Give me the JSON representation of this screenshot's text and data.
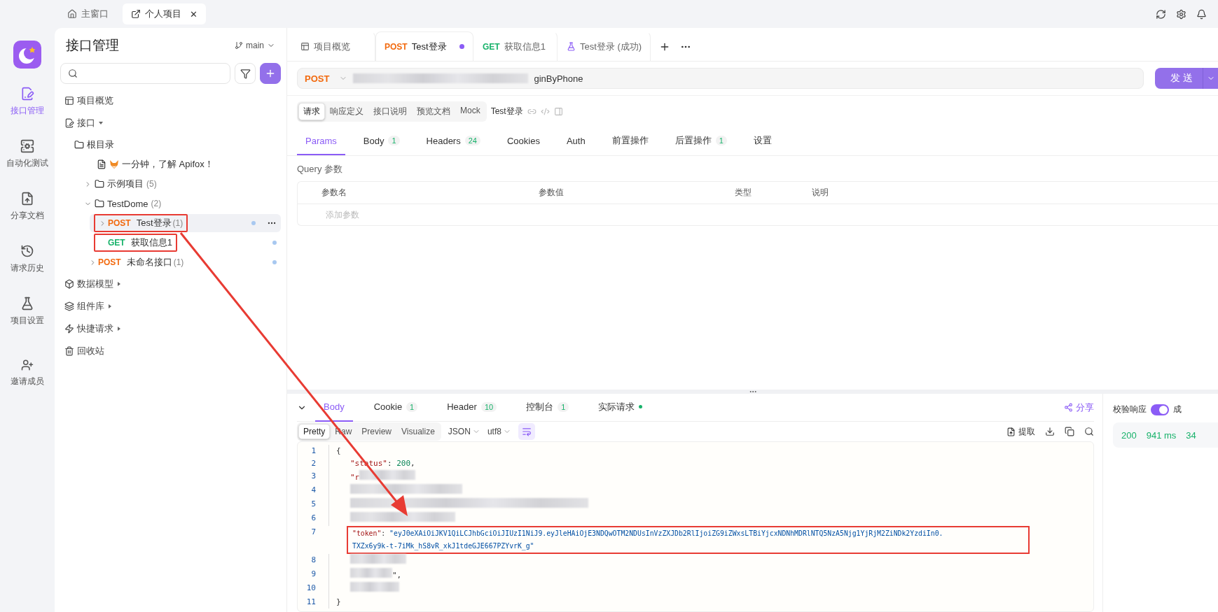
{
  "top_tabs": [
    {
      "kind": "home",
      "label": "主窗口",
      "selected": false
    },
    {
      "kind": "project",
      "label": "个人项目",
      "selected": true,
      "close": "✕"
    }
  ],
  "rail": {
    "items": [
      {
        "label": "接口管理",
        "selected": true
      },
      {
        "label": "自动化测试",
        "selected": false
      },
      {
        "label": "分享文档",
        "selected": false
      },
      {
        "label": "请求历史",
        "selected": false
      },
      {
        "label": "项目设置",
        "selected": false
      }
    ],
    "footer": {
      "label": "邀请成员"
    }
  },
  "sidebar": {
    "title": "接口管理",
    "branch": "main",
    "items": [
      {
        "kind": "overview",
        "label": "项目概览"
      },
      {
        "kind": "api",
        "label": "接口",
        "expanded": true,
        "children": [
          {
            "kind": "root",
            "label": "根目录",
            "children": [
              {
                "kind": "doc",
                "label": "一分钟，了解 Apifox！"
              },
              {
                "kind": "folder",
                "label": "示例项目",
                "count": "(5)",
                "expanded": false
              },
              {
                "kind": "folder",
                "label": "TestDome",
                "count": "(2)",
                "expanded": true,
                "children": [
                  {
                    "kind": "endpoint",
                    "method": "POST",
                    "color": "#f26a0f",
                    "label": "Test登录",
                    "count": "(1)",
                    "expandable": true,
                    "selected": true,
                    "annotated": true
                  },
                  {
                    "kind": "endpoint",
                    "method": "GET",
                    "color": "#17b26a",
                    "label": "获取信息1",
                    "expandable": false,
                    "selected": false,
                    "annotated": true
                  }
                ]
              },
              {
                "kind": "endpoint",
                "method": "POST",
                "color": "#f26a0f",
                "label": "未命名接口",
                "count": "(1)",
                "expandable": true,
                "selected": false,
                "annotated": false
              }
            ]
          }
        ]
      },
      {
        "kind": "model",
        "label": "数据模型",
        "expanded": false
      },
      {
        "kind": "components",
        "label": "组件库",
        "expanded": false
      },
      {
        "kind": "quick",
        "label": "快捷请求",
        "expanded": false
      },
      {
        "kind": "trash",
        "label": "回收站"
      }
    ]
  },
  "editor_tabs": [
    {
      "kind": "overview",
      "label": "项目概览",
      "selected": false
    },
    {
      "kind": "endpoint",
      "method": "POST",
      "color": "#f26a0f",
      "label": "Test登录",
      "selected": true,
      "modified": true
    },
    {
      "kind": "endpoint",
      "method": "GET",
      "color": "#17b26a",
      "label": "获取信息1",
      "selected": false,
      "modified": false
    },
    {
      "kind": "case",
      "label": "Test登录 (成功)",
      "selected": false
    }
  ],
  "request": {
    "method": "POST",
    "color": "#f26a0f",
    "url": "ginByPhone",
    "send": "发送"
  },
  "mode_tabs": [
    {
      "label": "请求",
      "selected": true
    },
    {
      "label": "响应定义",
      "selected": false
    },
    {
      "label": "接口说明",
      "selected": false
    },
    {
      "label": "预览文档",
      "selected": false
    },
    {
      "label": "Mock",
      "selected": false
    }
  ],
  "api_name": "Test登录",
  "param_tabs": [
    {
      "label": "Params",
      "selected": true
    },
    {
      "label": "Body",
      "count": "1",
      "selected": false
    },
    {
      "label": "Headers",
      "count": "24",
      "selected": false
    },
    {
      "label": "Cookies",
      "selected": false
    },
    {
      "label": "Auth",
      "selected": false
    },
    {
      "label": "前置操作",
      "selected": false
    },
    {
      "label": "后置操作",
      "count": "1",
      "selected": false
    },
    {
      "label": "设置",
      "selected": false
    }
  ],
  "query": {
    "title": "Query 参数",
    "columns": [
      "参数名",
      "参数值",
      "类型",
      "说明"
    ],
    "placeholder": "添加参数"
  },
  "response": {
    "tabs": [
      {
        "label": "Body",
        "selected": true
      },
      {
        "label": "Cookie",
        "count": "1",
        "selected": false
      },
      {
        "label": "Header",
        "count": "10",
        "selected": false
      },
      {
        "label": "控制台",
        "count": "1",
        "selected": false
      },
      {
        "label": "实际请求",
        "dot": true,
        "selected": false
      }
    ],
    "share": "分享",
    "views": [
      {
        "label": "Pretty",
        "selected": true
      },
      {
        "label": "Raw",
        "selected": false
      },
      {
        "label": "Preview",
        "selected": false
      },
      {
        "label": "Visualize",
        "selected": false
      }
    ],
    "format": "JSON",
    "encoding": "utf8",
    "extract": "提取",
    "lines": [
      {
        "number": "1",
        "segments": [
          {
            "kind": "punct",
            "text": "{"
          }
        ]
      },
      {
        "number": "2",
        "segments": [
          {
            "kind": "key",
            "text": "\"status\""
          },
          {
            "kind": "punct",
            "text": ": "
          },
          {
            "kind": "number",
            "text": "200"
          },
          {
            "kind": "punct",
            "text": ","
          }
        ]
      },
      {
        "number": "3",
        "segments": [
          {
            "kind": "key",
            "text": "\"r"
          },
          {
            "kind": "blur"
          }
        ]
      },
      {
        "number": "4",
        "segments": [
          {
            "kind": "blur"
          }
        ]
      },
      {
        "number": "5",
        "segments": [
          {
            "kind": "blur"
          }
        ]
      },
      {
        "number": "6",
        "segments": [
          {
            "kind": "blur"
          }
        ]
      },
      {
        "number": "7",
        "annotated": true,
        "segments": [
          {
            "kind": "key",
            "text": "\"token\""
          },
          {
            "kind": "punct",
            "text": ": "
          },
          {
            "kind": "string",
            "text": "\"eyJ0eXAiOiJKV1QiLCJhbGciOiJIUzI1NiJ9.eyJleHAiOjE3NDQwOTM2NDUsInVzZXJDb2RlIjoiZG9iZWxsLTBiYjcxNDNhMDRlNTQ5NzA5Njg1YjRjM2ZiNDk2YzdiIn0."
          }
        ],
        "wrap": "TXZx6y9k-t-7iMk_hS8vR_xkJ1tdeGJE667PZYvrK_g\""
      },
      {
        "number": "8",
        "segments": [
          {
            "kind": "blur"
          }
        ]
      },
      {
        "number": "9",
        "segments": [
          {
            "kind": "blur"
          },
          {
            "kind": "punct",
            "text": "\","
          }
        ]
      },
      {
        "number": "10",
        "segments": [
          {
            "kind": "blur"
          }
        ]
      },
      {
        "number": "11",
        "segments": [
          {
            "kind": "punct",
            "text": "}"
          }
        ]
      }
    ]
  },
  "result": {
    "validate_label": "校验响应",
    "validate_on": true,
    "status_label": "成",
    "status": "200",
    "time": "941 ms",
    "size": "34"
  }
}
